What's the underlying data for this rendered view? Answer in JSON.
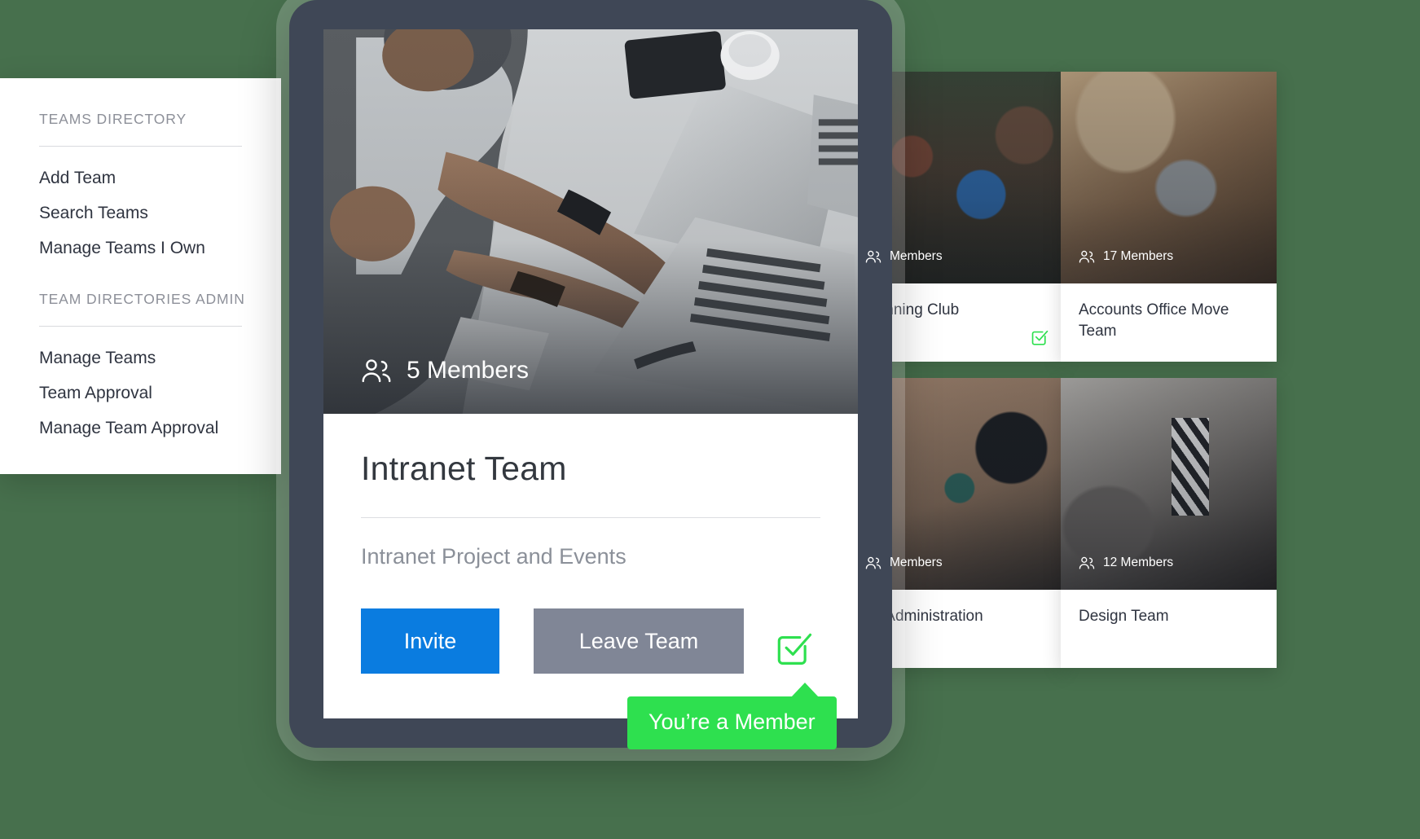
{
  "theme": {
    "background_green": "#47704d",
    "accent_blue": "#0a7ce0",
    "accent_gray": "#808696",
    "accent_green": "#2ee04f",
    "device_bezel": "#3f4756"
  },
  "sidebar": {
    "section1": {
      "heading": "TEAMS DIRECTORY",
      "items": [
        {
          "label": "Add Team"
        },
        {
          "label": "Search Teams"
        },
        {
          "label": "Manage Teams I Own"
        }
      ]
    },
    "section2": {
      "heading": "TEAM DIRECTORIES ADMIN",
      "items": [
        {
          "label": "Manage Teams"
        },
        {
          "label": "Team Approval"
        },
        {
          "label": "Manage Team Approval"
        }
      ]
    }
  },
  "featured_card": {
    "members_label": "5 Members",
    "members_icon": "people-icon",
    "title": "Intranet Team",
    "subtitle": "Intranet Project and Events",
    "primary_button": "Invite",
    "secondary_button": "Leave Team",
    "member_badge_icon": "checkbox-check-icon"
  },
  "tooltip": {
    "text": "You’re a Member"
  },
  "grid_cards": [
    {
      "id": "running-club",
      "members_label": "Members",
      "members_icon": "people-icon",
      "title": "Running Club",
      "has_member_check": true,
      "check_icon": "checkbox-check-icon",
      "photo": "ph-run"
    },
    {
      "id": "accounts-office-move-team",
      "members_label": "17 Members",
      "members_icon": "people-icon",
      "title": "Accounts Office Move Team",
      "has_member_check": false,
      "check_icon": "",
      "photo": "ph-cat"
    },
    {
      "id": "office-administration-team",
      "members_label": "Members",
      "members_icon": "people-icon",
      "title": "ce Administration\nm",
      "has_member_check": false,
      "check_icon": "",
      "photo": "ph-office"
    },
    {
      "id": "design-team",
      "members_label": "12 Members",
      "members_icon": "people-icon",
      "title": "Design Team",
      "has_member_check": false,
      "check_icon": "",
      "photo": "ph-design"
    }
  ]
}
